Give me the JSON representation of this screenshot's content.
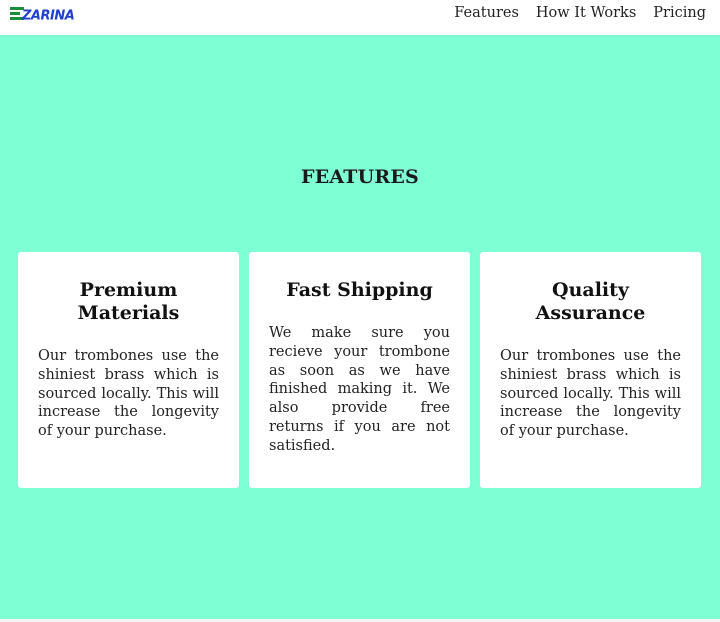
{
  "header": {
    "logo_text": "ZARINA",
    "nav": [
      {
        "label": "Features"
      },
      {
        "label": "How It Works"
      },
      {
        "label": "Pricing"
      }
    ]
  },
  "features": {
    "title": "FEATURES",
    "cards": [
      {
        "title": "Premium Materials",
        "text": "Our trombones use the shiniest brass which is sourced locally. This will increase the longevity of your purchase."
      },
      {
        "title": "Fast Shipping",
        "text": "We make sure you recieve your trombone as soon as we have finished making it. We also provide free returns if you are not satisfied."
      },
      {
        "title": "Quality Assurance",
        "text": "Our trombones use the shiniest brass which is sourced locally. This will increase the longevity of your purchase."
      }
    ]
  },
  "colors": {
    "background": "#7fffd4",
    "card": "#ffffff",
    "logo_green": "#1a8f3a",
    "logo_blue": "#1f3fd1"
  }
}
